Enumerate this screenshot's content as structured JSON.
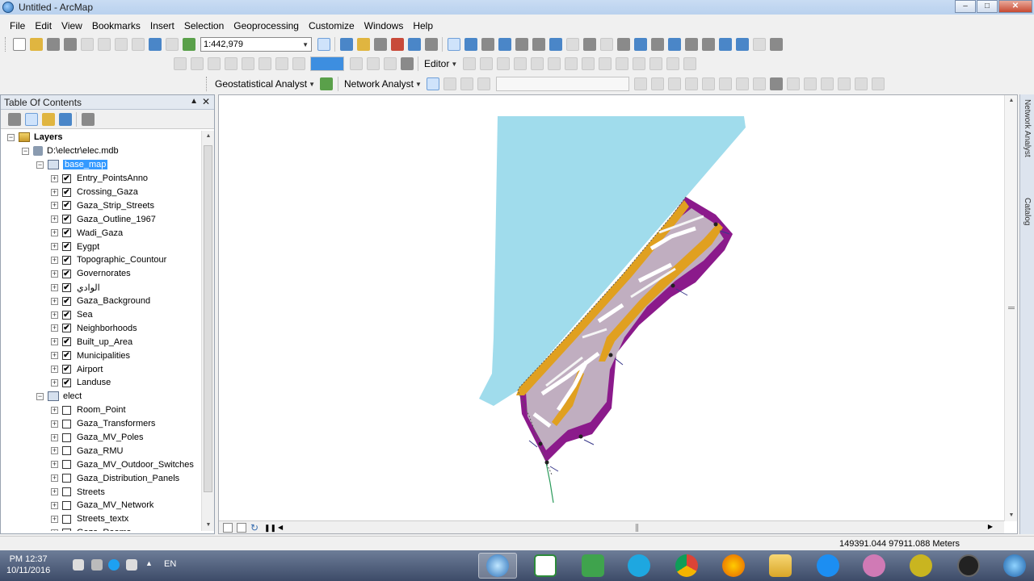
{
  "window": {
    "title": "Untitled - ArcMap"
  },
  "menu": [
    "File",
    "Edit",
    "View",
    "Bookmarks",
    "Insert",
    "Selection",
    "Geoprocessing",
    "Customize",
    "Windows",
    "Help"
  ],
  "toolbar": {
    "scale_value": "1:442,979",
    "editor_label": "Editor",
    "geostat_label": "Geostatistical Analyst",
    "network_label": "Network Analyst"
  },
  "toc": {
    "title": "Table Of Contents",
    "root_label": "Layers",
    "db_label": "D:\\electr\\elec.mdb",
    "group1": {
      "label": "base_map",
      "layers": [
        {
          "name": "Entry_PointsAnno",
          "checked": true
        },
        {
          "name": "Crossing_Gaza",
          "checked": true
        },
        {
          "name": "Gaza_Strip_Streets",
          "checked": true
        },
        {
          "name": "Gaza_Outline_1967",
          "checked": true
        },
        {
          "name": "Wadi_Gaza",
          "checked": true
        },
        {
          "name": "Eygpt",
          "checked": true
        },
        {
          "name": "Topographic_Countour",
          "checked": true
        },
        {
          "name": "Governorates",
          "checked": true
        },
        {
          "name": "الوادي",
          "checked": true
        },
        {
          "name": "Gaza_Background",
          "checked": true
        },
        {
          "name": "Sea",
          "checked": true
        },
        {
          "name": "Neighborhoods",
          "checked": true
        },
        {
          "name": "Built_up_Area",
          "checked": true
        },
        {
          "name": "Municipalities",
          "checked": true
        },
        {
          "name": "Airport",
          "checked": true
        },
        {
          "name": "Landuse",
          "checked": true
        }
      ]
    },
    "group2": {
      "label": "elect",
      "layers": [
        {
          "name": "Room_Point",
          "checked": false
        },
        {
          "name": "Gaza_Transformers",
          "checked": false
        },
        {
          "name": "Gaza_MV_Poles",
          "checked": false
        },
        {
          "name": "Gaza_RMU",
          "checked": false
        },
        {
          "name": "Gaza_MV_Outdoor_Switches",
          "checked": false
        },
        {
          "name": "Gaza_Distribution_Panels",
          "checked": false
        },
        {
          "name": "Streets",
          "checked": false
        },
        {
          "name": "Gaza_MV_Network",
          "checked": false
        },
        {
          "name": "Streets_textx",
          "checked": false
        },
        {
          "name": "Gaza_Rooms",
          "checked": false
        }
      ]
    }
  },
  "dock": {
    "tab1": "Network Analyst",
    "tab2": "Catalog"
  },
  "status": {
    "coordinates": "149391.044  97911.088 Meters"
  },
  "taskbar": {
    "time": "PM 12:37",
    "date": "10/11/2016",
    "lang": "EN"
  },
  "colors": {
    "sea": "#a0dcec",
    "builtup": "#e0a020",
    "landuse": "#8b1a8b",
    "gray": "#c0c0c0"
  }
}
